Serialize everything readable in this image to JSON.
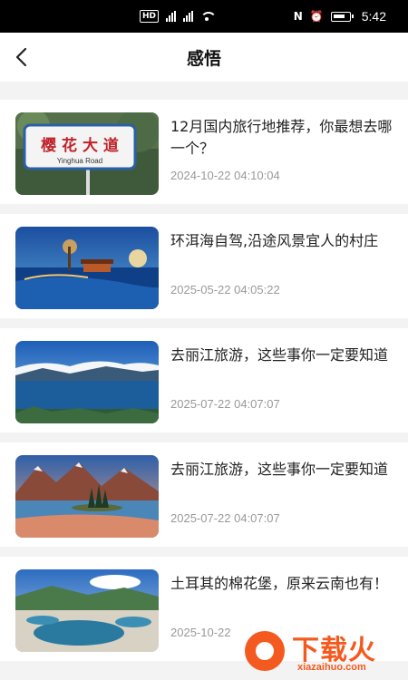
{
  "status_bar": {
    "left_indicators": [
      "HD",
      "5G",
      "4G"
    ],
    "time": "5:42"
  },
  "header": {
    "title": "感悟",
    "back_icon": "chevron-left-icon"
  },
  "articles": [
    {
      "title": "12月国内旅行地推荐，你最想去哪一个？",
      "date": "2024-10-22 04:10:04",
      "image": "cherry-blossom-road-sign",
      "sign_text": "樱 花 大 道",
      "sign_subtext": "Yinghua Road"
    },
    {
      "title": "环洱海自驾,沿途风景宜人的村庄",
      "date": "2025-05-22 04:05:22",
      "image": "lakeside-village"
    },
    {
      "title": "去丽江旅游，这些事你一定要知道",
      "date": "2025-07-22 04:07:07",
      "image": "blue-lake-mountains"
    },
    {
      "title": "去丽江旅游，这些事你一定要知道",
      "date": "2025-07-22 04:07:07",
      "image": "mountain-lake-island"
    },
    {
      "title": "土耳其的棉花堡，原来云南也有！",
      "date": "2025-10-22",
      "image": "terraced-pools"
    }
  ],
  "watermark": {
    "name": "下载火",
    "url": "xiazaihuo.com"
  },
  "colors": {
    "accent": "#f45a1f",
    "date_text": "#999999",
    "background": "#f3f3f3"
  }
}
